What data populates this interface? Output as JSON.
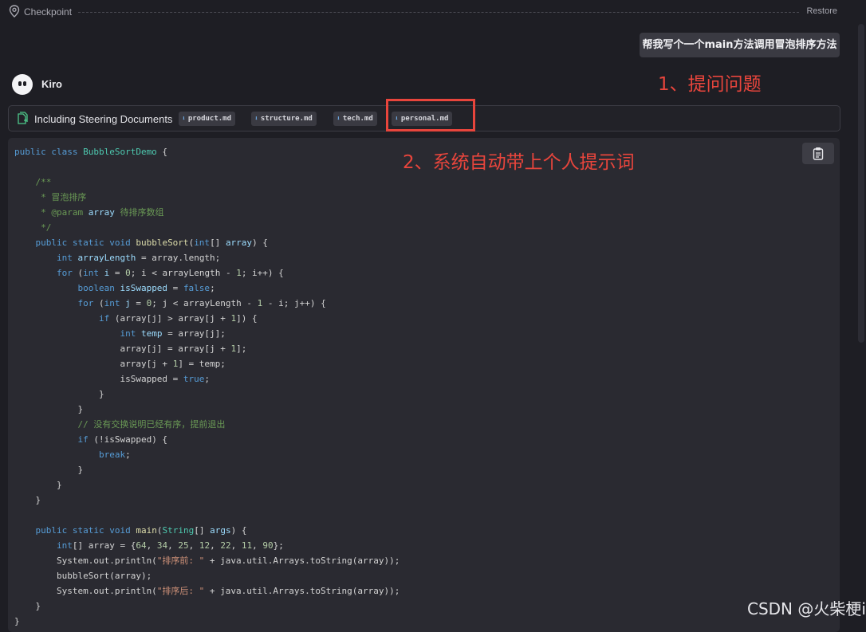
{
  "checkpoint": {
    "label": "Checkpoint",
    "restore": "Restore"
  },
  "user_message": "帮我写个一个main方法调用冒泡排序方法",
  "assistant": {
    "name": "Kiro"
  },
  "steering": {
    "label": "Including Steering Documents",
    "docs": [
      "product.md",
      "structure.md",
      "tech.md",
      "personal.md"
    ]
  },
  "annotations": {
    "a1": "1、提问问题",
    "a2": "2、系统自动带上个人提示词"
  },
  "colors": {
    "annotation": "#e8453c",
    "background": "#1e1e24",
    "code_bg": "#2a2a31"
  },
  "code_lines": [
    [
      [
        "kw",
        "public class "
      ],
      [
        "cl",
        "BubbleSortDemo"
      ],
      [
        "pl",
        " {"
      ]
    ],
    [],
    [
      [
        "cm",
        "    /**"
      ]
    ],
    [
      [
        "cm",
        "     * 冒泡排序"
      ]
    ],
    [
      [
        "cm",
        "     * @param "
      ],
      [
        "vr",
        "array"
      ],
      [
        "cm",
        " 待排序数组"
      ]
    ],
    [
      [
        "cm",
        "     */"
      ]
    ],
    [
      [
        "kw",
        "    public static void "
      ],
      [
        "fn",
        "bubbleSort"
      ],
      [
        "pl",
        "("
      ],
      [
        "kw",
        "int"
      ],
      [
        "pl",
        "[] "
      ],
      [
        "vr",
        "array"
      ],
      [
        "pl",
        ") {"
      ]
    ],
    [
      [
        "kw",
        "        int "
      ],
      [
        "vr",
        "arrayLength"
      ],
      [
        "pl",
        " = array.length;"
      ]
    ],
    [
      [
        "kw",
        "        for "
      ],
      [
        "pl",
        "("
      ],
      [
        "kw",
        "int "
      ],
      [
        "vr",
        "i"
      ],
      [
        "pl",
        " = "
      ],
      [
        "nm",
        "0"
      ],
      [
        "pl",
        "; i < arrayLength - "
      ],
      [
        "nm",
        "1"
      ],
      [
        "pl",
        "; i++) {"
      ]
    ],
    [
      [
        "kw",
        "            boolean "
      ],
      [
        "vr",
        "isSwapped"
      ],
      [
        "pl",
        " = "
      ],
      [
        "kw",
        "false"
      ],
      [
        "pl",
        ";"
      ]
    ],
    [
      [
        "kw",
        "            for "
      ],
      [
        "pl",
        "("
      ],
      [
        "kw",
        "int "
      ],
      [
        "vr",
        "j"
      ],
      [
        "pl",
        " = "
      ],
      [
        "nm",
        "0"
      ],
      [
        "pl",
        "; j < arrayLength - "
      ],
      [
        "nm",
        "1"
      ],
      [
        "pl",
        " - i; j++) {"
      ]
    ],
    [
      [
        "kw",
        "                if "
      ],
      [
        "pl",
        "(array[j] > array[j + "
      ],
      [
        "nm",
        "1"
      ],
      [
        "pl",
        "]) {"
      ]
    ],
    [
      [
        "kw",
        "                    int "
      ],
      [
        "vr",
        "temp"
      ],
      [
        "pl",
        " = array[j];"
      ]
    ],
    [
      [
        "pl",
        "                    array[j] = array[j + "
      ],
      [
        "nm",
        "1"
      ],
      [
        "pl",
        "];"
      ]
    ],
    [
      [
        "pl",
        "                    array[j + "
      ],
      [
        "nm",
        "1"
      ],
      [
        "pl",
        "] = temp;"
      ]
    ],
    [
      [
        "pl",
        "                    isSwapped = "
      ],
      [
        "kw",
        "true"
      ],
      [
        "pl",
        ";"
      ]
    ],
    [
      [
        "pl",
        "                }"
      ]
    ],
    [
      [
        "pl",
        "            }"
      ]
    ],
    [
      [
        "cm",
        "            // 没有交换说明已经有序，提前退出"
      ]
    ],
    [
      [
        "kw",
        "            if "
      ],
      [
        "pl",
        "(!isSwapped) {"
      ]
    ],
    [
      [
        "kw",
        "                break"
      ],
      [
        "pl",
        ";"
      ]
    ],
    [
      [
        "pl",
        "            }"
      ]
    ],
    [
      [
        "pl",
        "        }"
      ]
    ],
    [
      [
        "pl",
        "    }"
      ]
    ],
    [],
    [
      [
        "kw",
        "    public static void "
      ],
      [
        "fn",
        "main"
      ],
      [
        "pl",
        "("
      ],
      [
        "cl",
        "String"
      ],
      [
        "pl",
        "[] "
      ],
      [
        "vr",
        "args"
      ],
      [
        "pl",
        ") {"
      ]
    ],
    [
      [
        "kw",
        "        int"
      ],
      [
        "pl",
        "[] array = {"
      ],
      [
        "nm",
        "64"
      ],
      [
        "pl",
        ", "
      ],
      [
        "nm",
        "34"
      ],
      [
        "pl",
        ", "
      ],
      [
        "nm",
        "25"
      ],
      [
        "pl",
        ", "
      ],
      [
        "nm",
        "12"
      ],
      [
        "pl",
        ", "
      ],
      [
        "nm",
        "22"
      ],
      [
        "pl",
        ", "
      ],
      [
        "nm",
        "11"
      ],
      [
        "pl",
        ", "
      ],
      [
        "nm",
        "90"
      ],
      [
        "pl",
        "};"
      ]
    ],
    [
      [
        "pl",
        "        System.out.println("
      ],
      [
        "st",
        "\"排序前: \""
      ],
      [
        "pl",
        " + java.util.Arrays.toString(array));"
      ]
    ],
    [
      [
        "pl",
        "        bubbleSort(array);"
      ]
    ],
    [
      [
        "pl",
        "        System.out.println("
      ],
      [
        "st",
        "\"排序后: \""
      ],
      [
        "pl",
        " + java.util.Arrays.toString(array));"
      ]
    ],
    [
      [
        "pl",
        "    }"
      ]
    ],
    [
      [
        "pl",
        "}"
      ]
    ]
  ],
  "watermark": "CSDN @火柴梗i"
}
